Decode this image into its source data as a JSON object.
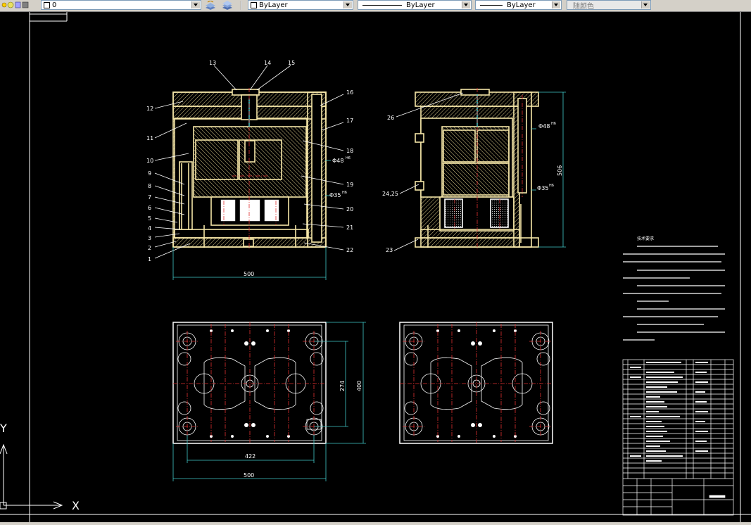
{
  "toolbar": {
    "layer_name": "0",
    "color_value": "ByLayer",
    "linetype_value": "ByLayer",
    "lineweight_value": "ByLayer",
    "plotstyle_value": "随颜色"
  },
  "drawing": {
    "dim_top_view_width": "500",
    "dim_side_height": "506",
    "dim_plan_height_inner": "274",
    "dim_plan_height_outer": "400",
    "dim_plan_width_inner": "422",
    "dim_plan_width_outer": "500",
    "dia_48_left": "Φ48",
    "dia_35_left": "Φ35",
    "dia_48_right": "Φ48",
    "dia_35_right": "Φ35",
    "tol_H6": "H6",
    "callouts_left": [
      "1",
      "2",
      "3",
      "4",
      "5",
      "6",
      "7",
      "8",
      "9",
      "10",
      "11",
      "12",
      "13",
      "14",
      "15",
      "16",
      "17",
      "18",
      "19",
      "20",
      "21",
      "22"
    ],
    "callouts_right": [
      "26",
      "24,25",
      "23"
    ],
    "tech_notes_title": "技术要求",
    "ucs_x": "X",
    "ucs_y": "Y"
  },
  "colors": {
    "mold_outline": "#f5e6a8",
    "hatch": "#f5e6a8",
    "centerline": "#e03030",
    "dimension": "#40c8c8",
    "text": "#ffffff",
    "frame": "#ffffff"
  }
}
